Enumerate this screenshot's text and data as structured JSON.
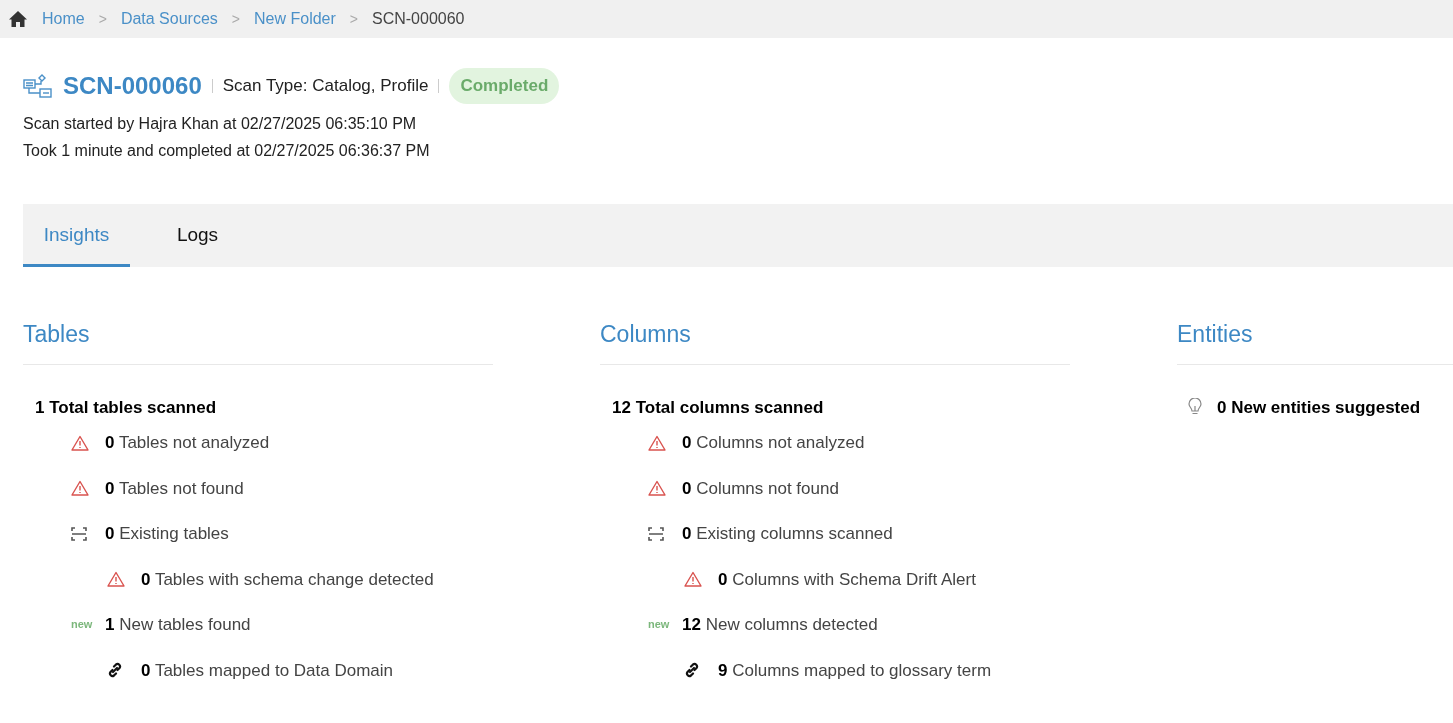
{
  "breadcrumb": [
    {
      "label": "Home",
      "link": true
    },
    {
      "label": "Data Sources",
      "link": true
    },
    {
      "label": "New Folder",
      "link": true
    },
    {
      "label": "SCN-000060",
      "link": false
    }
  ],
  "separator": ">",
  "header": {
    "title": "SCN-000060",
    "scan_type": "Scan Type: Catalog, Profile",
    "status": "Completed",
    "started": "Scan started by Hajra Khan at 02/27/2025 06:35:10 PM",
    "completed": "Took 1 minute and completed at 02/27/2025 06:36:37 PM"
  },
  "tabs": [
    {
      "label": "Insights",
      "selected": true
    },
    {
      "label": "Logs",
      "selected": false
    }
  ],
  "sections": [
    {
      "title": "Tables",
      "summary": "1 Total tables scanned",
      "items": [
        {
          "kind": "warning",
          "count": "0",
          "label": "Tables not analyzed"
        },
        {
          "kind": "warning",
          "count": "0",
          "label": "Tables not found"
        },
        {
          "kind": "existing",
          "count": "0",
          "label": "Existing tables",
          "children": [
            {
              "kind": "warning",
              "count": "0",
              "label": "Tables with schema change detected"
            }
          ]
        },
        {
          "kind": "new",
          "badge": "new",
          "count": "1",
          "label": "New tables found",
          "children": [
            {
              "kind": "link",
              "count": "0",
              "label": "Tables mapped to Data Domain"
            }
          ]
        }
      ]
    },
    {
      "title": "Columns",
      "summary": "12 Total columns scanned",
      "items": [
        {
          "kind": "warning",
          "count": "0",
          "label": "Columns not analyzed"
        },
        {
          "kind": "warning",
          "count": "0",
          "label": "Columns not found"
        },
        {
          "kind": "existing",
          "count": "0",
          "label": "Existing columns scanned",
          "children": [
            {
              "kind": "warning",
              "count": "0",
              "label": "Columns with Schema Drift Alert"
            }
          ]
        },
        {
          "kind": "new",
          "badge": "new",
          "count": "12",
          "label": "New columns detected",
          "children": [
            {
              "kind": "link",
              "count": "9",
              "label": "Columns mapped to glossary term"
            }
          ]
        }
      ]
    },
    {
      "title": "Entities",
      "suggestion": "0 New entities suggested"
    }
  ]
}
